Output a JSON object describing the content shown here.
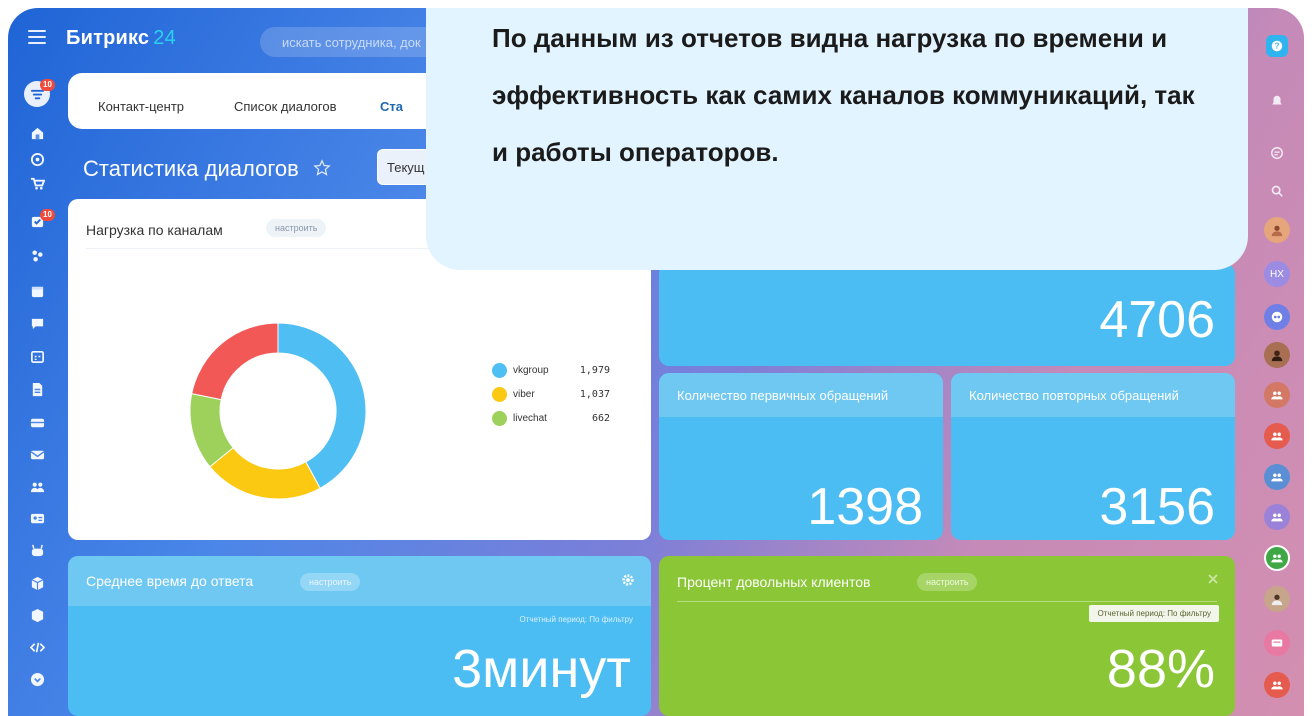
{
  "header": {
    "logo_text": "Битрикс",
    "logo_number": "24",
    "search_placeholder": "искать сотрудника, док"
  },
  "left_sidebar": {
    "badges": [
      "10",
      "10"
    ],
    "items": [
      "filter-icon",
      "home-icon",
      "target-icon",
      "cart-icon",
      "task-icon",
      "crm-icon",
      "calendar-icon",
      "chat-icon",
      "schedule-icon",
      "document-icon",
      "drive-icon",
      "mail-icon",
      "group-icon",
      "contact-icon",
      "robot-icon",
      "box-icon",
      "package-icon",
      "code-icon",
      "more-icon"
    ]
  },
  "tabs": {
    "items": [
      "Контакт-центр",
      "Список диалогов",
      "Ста"
    ]
  },
  "page": {
    "title": "Статистика диалогов",
    "period_button": "Текущ"
  },
  "widgets": {
    "channels": {
      "title": "Нагрузка по каналам",
      "configure": "настроить"
    },
    "total": {
      "value": "4706"
    },
    "primary": {
      "title": "Количество первичных обращений",
      "value": "1398"
    },
    "repeat": {
      "title": "Количество повторных обращений",
      "value": "3156"
    },
    "response_time": {
      "title": "Среднее время до ответа",
      "configure": "настроить",
      "period": "Отчетный период: По фильтру",
      "value": "3минут"
    },
    "satisfaction": {
      "title": "Процент довольных клиентов",
      "configure": "настроить",
      "period": "Отчетный период: По фильтру",
      "value": "88%"
    }
  },
  "chart_data": {
    "type": "pie",
    "categories": [
      "vkgroup",
      "viber",
      "livechat",
      ""
    ],
    "values": [
      1979,
      1037,
      662,
      1028
    ],
    "labels": [
      "1,979",
      "1,037",
      "662"
    ],
    "colors": [
      "#4fbff3",
      "#fbc812",
      "#9dd15b",
      "#f25856"
    ],
    "legend": "right"
  },
  "callout": {
    "text": "По данным из отчетов видна нагрузка по времени и эффективность как самих каналов коммуникаций, так и работы операторов."
  },
  "right_rail": {
    "avatar_initials": "НХ"
  },
  "colors": {
    "accent": "#2067b0",
    "widget_blue": "#4cbdf3",
    "widget_green": "#8ac635",
    "callout_bg": "#e2f4ff"
  }
}
